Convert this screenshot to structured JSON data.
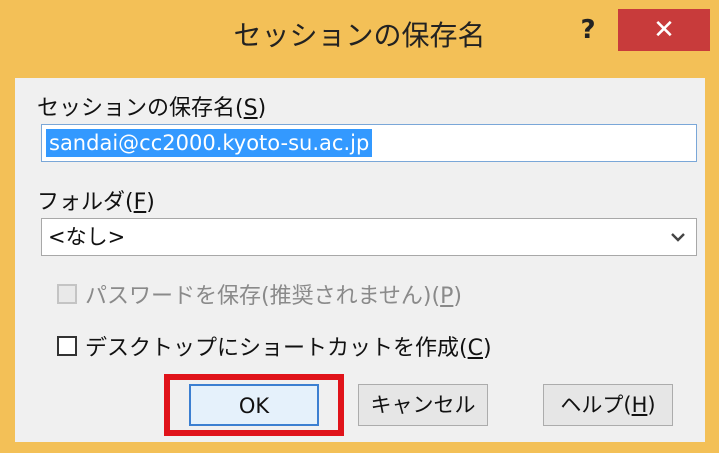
{
  "window": {
    "title": "セッションの保存名",
    "help_glyph": "?",
    "close_glyph": "✕"
  },
  "session_name": {
    "label": "セッションの保存名",
    "accel": "S",
    "value": "sandai@cc2000.kyoto-su.ac.jp"
  },
  "folder": {
    "label": "フォルダ",
    "accel": "F",
    "selected": "<なし>"
  },
  "save_password": {
    "label": "パスワードを保存(推奨されません)",
    "accel": "P",
    "checked": false,
    "enabled": false
  },
  "desktop_shortcut": {
    "label": "デスクトップにショートカットを作成",
    "accel": "C",
    "checked": false
  },
  "buttons": {
    "ok": "OK",
    "cancel": "キャンセル",
    "help_label": "ヘルプ",
    "help_accel": "H"
  },
  "colors": {
    "titlebar": "#f3c057",
    "close": "#c83b3b",
    "selection": "#3399ff",
    "highlight": "#e0131a"
  }
}
